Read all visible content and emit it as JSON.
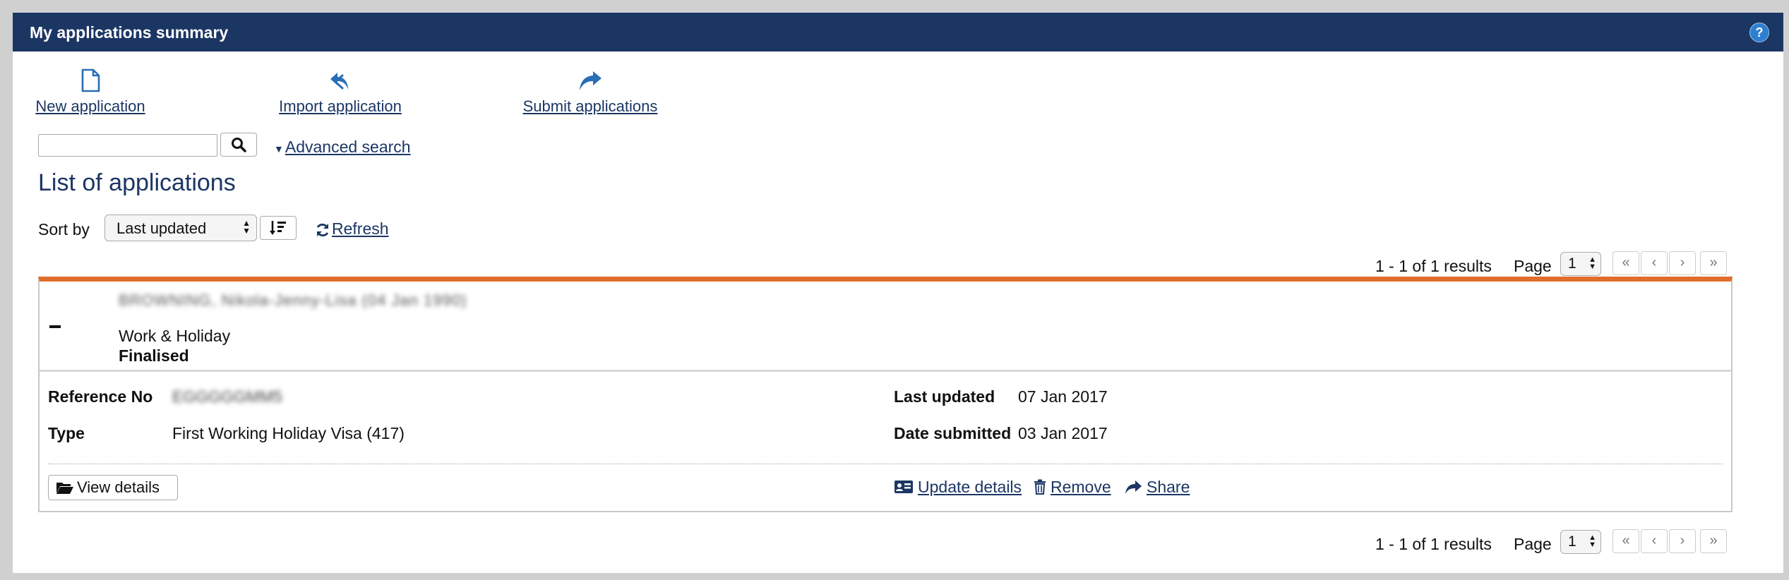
{
  "panel": {
    "title": "My applications summary",
    "help_label": "?"
  },
  "actions": [
    {
      "label": "New application",
      "icon": "document-icon"
    },
    {
      "label": "Import application",
      "icon": "import-reply-icon"
    },
    {
      "label": "Submit applications",
      "icon": "share-forward-icon"
    }
  ],
  "search": {
    "value": "",
    "placeholder": "",
    "advanced_label": "Advanced search"
  },
  "list": {
    "title": "List of applications",
    "sort_label": "Sort by",
    "sort_value": "Last updated",
    "refresh_label": "Refresh"
  },
  "pagination": {
    "results_text": "1 - 1 of 1 results",
    "page_label": "Page",
    "page_value": "1",
    "first": "«",
    "prev": "‹",
    "next": "›",
    "last": "»"
  },
  "application": {
    "applicant_name": "BROWNING, Nikola-Jenny-Lisa (04 Jan 1990)",
    "visa_class": "Work & Holiday",
    "status": "Finalised",
    "reference_label": "Reference No",
    "reference_value": "EGGGGGMM5",
    "type_label": "Type",
    "type_value": "First Working Holiday Visa (417)",
    "last_updated_label": "Last updated",
    "last_updated_value": "07 Jan 2017",
    "date_submitted_label": "Date submitted",
    "date_submitted_value": "03 Jan 2017",
    "view_details_label": "View details",
    "update_details_label": "Update details",
    "remove_label": "Remove",
    "share_label": "Share"
  },
  "colors": {
    "header_bg": "#1c3664",
    "accent_orange": "#e06e2a",
    "link": "#1c3664",
    "icon_blue": "#2a6db5"
  }
}
